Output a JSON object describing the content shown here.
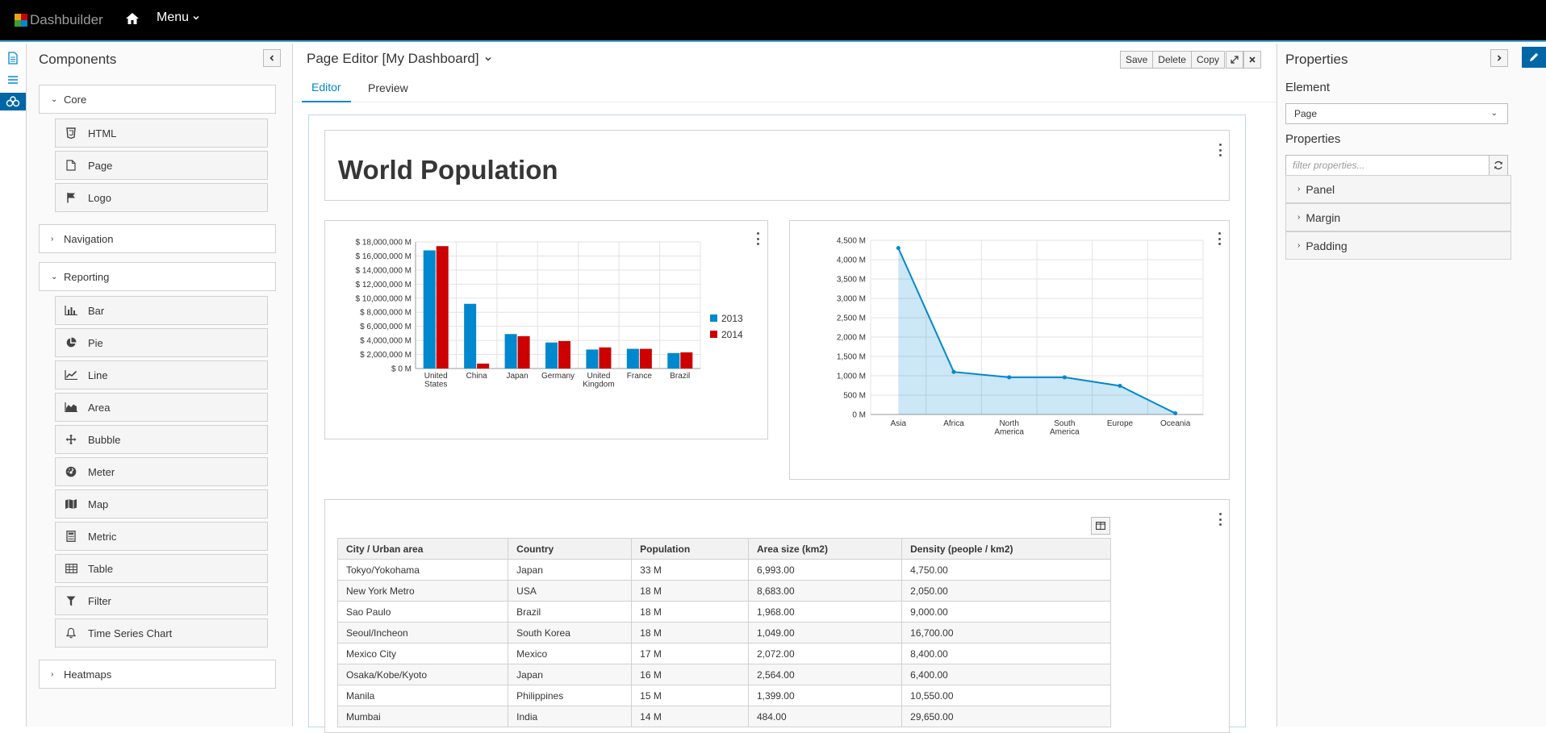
{
  "topbar": {
    "app_name": "Dashbuilder",
    "menu_label": "Menu"
  },
  "components": {
    "title": "Components",
    "groups": [
      {
        "label": "Core",
        "items": [
          "HTML",
          "Page",
          "Logo"
        ]
      },
      {
        "label": "Navigation"
      },
      {
        "label": "Reporting",
        "items": [
          "Bar",
          "Pie",
          "Line",
          "Area",
          "Bubble",
          "Meter",
          "Map",
          "Metric",
          "Table",
          "Filter",
          "Time Series Chart"
        ]
      },
      {
        "label": "Heatmaps"
      }
    ]
  },
  "editor": {
    "title": "Page Editor [My Dashboard]",
    "buttons": {
      "save": "Save",
      "delete": "Delete",
      "copy": "Copy"
    },
    "tabs": [
      "Editor",
      "Preview"
    ],
    "heading": "World Population"
  },
  "bar_chart": {
    "ticks": [
      "$ 18,000,000 M",
      "$ 16,000,000 M",
      "$ 14,000,000 M",
      "$ 12,000,000 M",
      "$ 10,000,000 M",
      "$ 8,000,000 M",
      "$ 6,000,000 M",
      "$ 4,000,000 M",
      "$ 2,000,000 M",
      "$ 0 M"
    ],
    "legend": [
      "2013",
      "2014"
    ]
  },
  "line_chart": {
    "ticks": [
      "4,500 M",
      "4,000 M",
      "3,500 M",
      "3,000 M",
      "2,500 M",
      "2,000 M",
      "1,500 M",
      "1,000 M",
      "500 M",
      "0 M"
    ]
  },
  "chart_data": [
    {
      "type": "bar",
      "categories": [
        "United States",
        "China",
        "Japan",
        "Germany",
        "United Kingdom",
        "France",
        "Brazil"
      ],
      "series": [
        {
          "name": "2013",
          "values": [
            16800000,
            9200000,
            4900000,
            3700000,
            2700000,
            2800000,
            2200000
          ]
        },
        {
          "name": "2014",
          "values": [
            17400000,
            700000,
            4600000,
            3900000,
            3000000,
            2800000,
            2300000
          ]
        }
      ],
      "ylim": [
        0,
        18000000
      ],
      "legend": "right",
      "colors": [
        "#0088ce",
        "#cc0000"
      ]
    },
    {
      "type": "area",
      "categories": [
        "Asia",
        "Africa",
        "North America",
        "South America",
        "Europe",
        "Oceania"
      ],
      "values": [
        4300,
        1100,
        960,
        960,
        740,
        30
      ],
      "ylim": [
        0,
        4500
      ],
      "color": "#0088ce"
    }
  ],
  "table": {
    "headers": [
      "City / Urban area",
      "Country",
      "Population",
      "Area size (km2)",
      "Density (people / km2)"
    ],
    "rows": [
      [
        "Tokyo/Yokohama",
        "Japan",
        "33 M",
        "6,993.00",
        "4,750.00"
      ],
      [
        "New York Metro",
        "USA",
        "18 M",
        "8,683.00",
        "2,050.00"
      ],
      [
        "Sao Paulo",
        "Brazil",
        "18 M",
        "1,968.00",
        "9,000.00"
      ],
      [
        "Seoul/Incheon",
        "South Korea",
        "18 M",
        "1,049.00",
        "16,700.00"
      ],
      [
        "Mexico City",
        "Mexico",
        "17 M",
        "2,072.00",
        "8,400.00"
      ],
      [
        "Osaka/Kobe/Kyoto",
        "Japan",
        "16 M",
        "2,564.00",
        "6,400.00"
      ],
      [
        "Manila",
        "Philippines",
        "15 M",
        "1,399.00",
        "10,550.00"
      ],
      [
        "Mumbai",
        "India",
        "14 M",
        "484.00",
        "29,650.00"
      ]
    ]
  },
  "properties": {
    "title": "Properties",
    "element_label": "Element",
    "element_value": "Page",
    "section_label": "Properties",
    "filter_placeholder": "filter properties...",
    "groups": [
      "Panel",
      "Margin",
      "Padding"
    ]
  }
}
